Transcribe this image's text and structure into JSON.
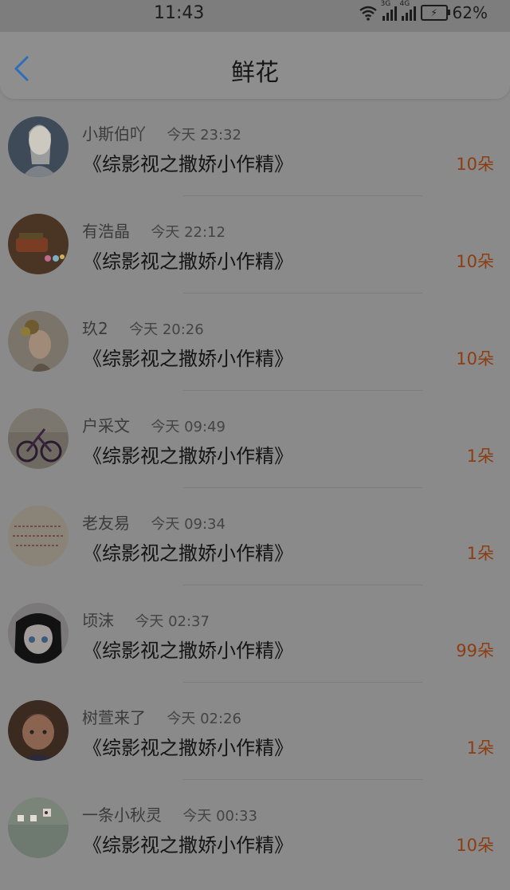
{
  "status_bar": {
    "time": "11:43",
    "net1": "3G",
    "net2": "4G",
    "battery": "62%"
  },
  "header": {
    "title": "鲜花",
    "back_icon": "chevron-left-icon",
    "accent": "#2a6fb8"
  },
  "colors": {
    "count": "#8c3d12"
  },
  "rows": [
    {
      "name": "小斯伯吖",
      "time": "今天 23:32",
      "book": "《综影视之撒娇小作精》",
      "count": "10朵"
    },
    {
      "name": "有浩晶",
      "time": "今天 22:12",
      "book": "《综影视之撒娇小作精》",
      "count": "10朵"
    },
    {
      "name": "玖2",
      "time": "今天 20:26",
      "book": "《综影视之撒娇小作精》",
      "count": "10朵"
    },
    {
      "name": "户采文",
      "time": "今天 09:49",
      "book": "《综影视之撒娇小作精》",
      "count": "1朵"
    },
    {
      "name": "老友易",
      "time": "今天 09:34",
      "book": "《综影视之撒娇小作精》",
      "count": "1朵"
    },
    {
      "name": "顷沫",
      "time": "今天 02:37",
      "book": "《综影视之撒娇小作精》",
      "count": "99朵"
    },
    {
      "name": "树萱来了",
      "time": "今天 02:26",
      "book": "《综影视之撒娇小作精》",
      "count": "1朵"
    },
    {
      "name": "一条小秋灵",
      "time": "今天 00:33",
      "book": "《综影视之撒娇小作精》",
      "count": "10朵"
    }
  ]
}
